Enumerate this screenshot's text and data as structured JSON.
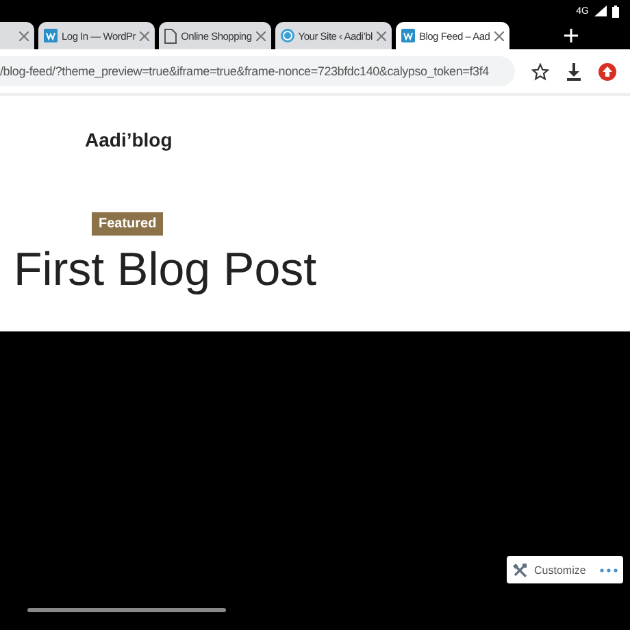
{
  "status_bar": {
    "network": "4G"
  },
  "tabs": [
    {
      "selected": false,
      "kind": "blank"
    },
    {
      "label": "Log In — WordPr",
      "selected": false,
      "kind": "wp"
    },
    {
      "label": "Online Shopping",
      "selected": false,
      "kind": "page"
    },
    {
      "label": "Your Site ‹ Aadi’bl",
      "selected": false,
      "kind": "wpcircle"
    },
    {
      "label": "Blog Feed – Aad",
      "selected": true,
      "kind": "wp"
    }
  ],
  "address_bar": {
    "url": "/blog-feed/?theme_preview=true&iframe=true&frame-nonce=723bfdc140&calypso_token=f3f4"
  },
  "page": {
    "site_title": "Aadi’blog",
    "tag": "Featured",
    "post_title": "First Blog Post"
  },
  "customize_bar": {
    "label": "Customize"
  }
}
